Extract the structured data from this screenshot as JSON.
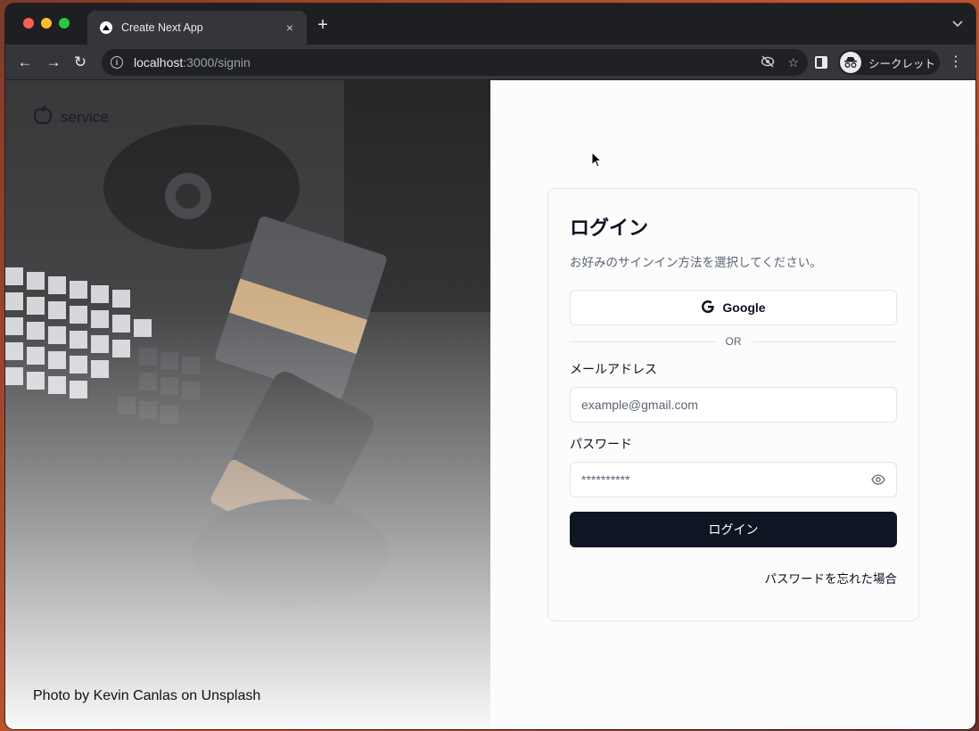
{
  "browser": {
    "tab_title": "Create Next App",
    "tab_close": "×",
    "new_tab": "+",
    "tab_search": "⌄",
    "url_host": "localhost",
    "url_path": ":3000/signin",
    "incognito_label": "シークレット",
    "nav": {
      "back": "←",
      "forward": "→",
      "reload": "↻"
    },
    "menu": "⋮",
    "star": "☆"
  },
  "hero": {
    "logo_name": "service",
    "photo_credit": "Photo by Kevin Canlas on Unsplash"
  },
  "login": {
    "title": "ログイン",
    "subtitle": "お好みのサインイン方法を選択してください。",
    "google_label": "Google",
    "divider_text": "OR",
    "email_label": "メールアドレス",
    "email_placeholder": "example@gmail.com",
    "password_label": "パスワード",
    "password_value": "**********",
    "submit_label": "ログイン",
    "forgot_label": "パスワードを忘れた場合"
  },
  "colors": {
    "primary_button": "#0f1522",
    "border": "#e3e5ea",
    "muted_text": "#5b6474"
  }
}
